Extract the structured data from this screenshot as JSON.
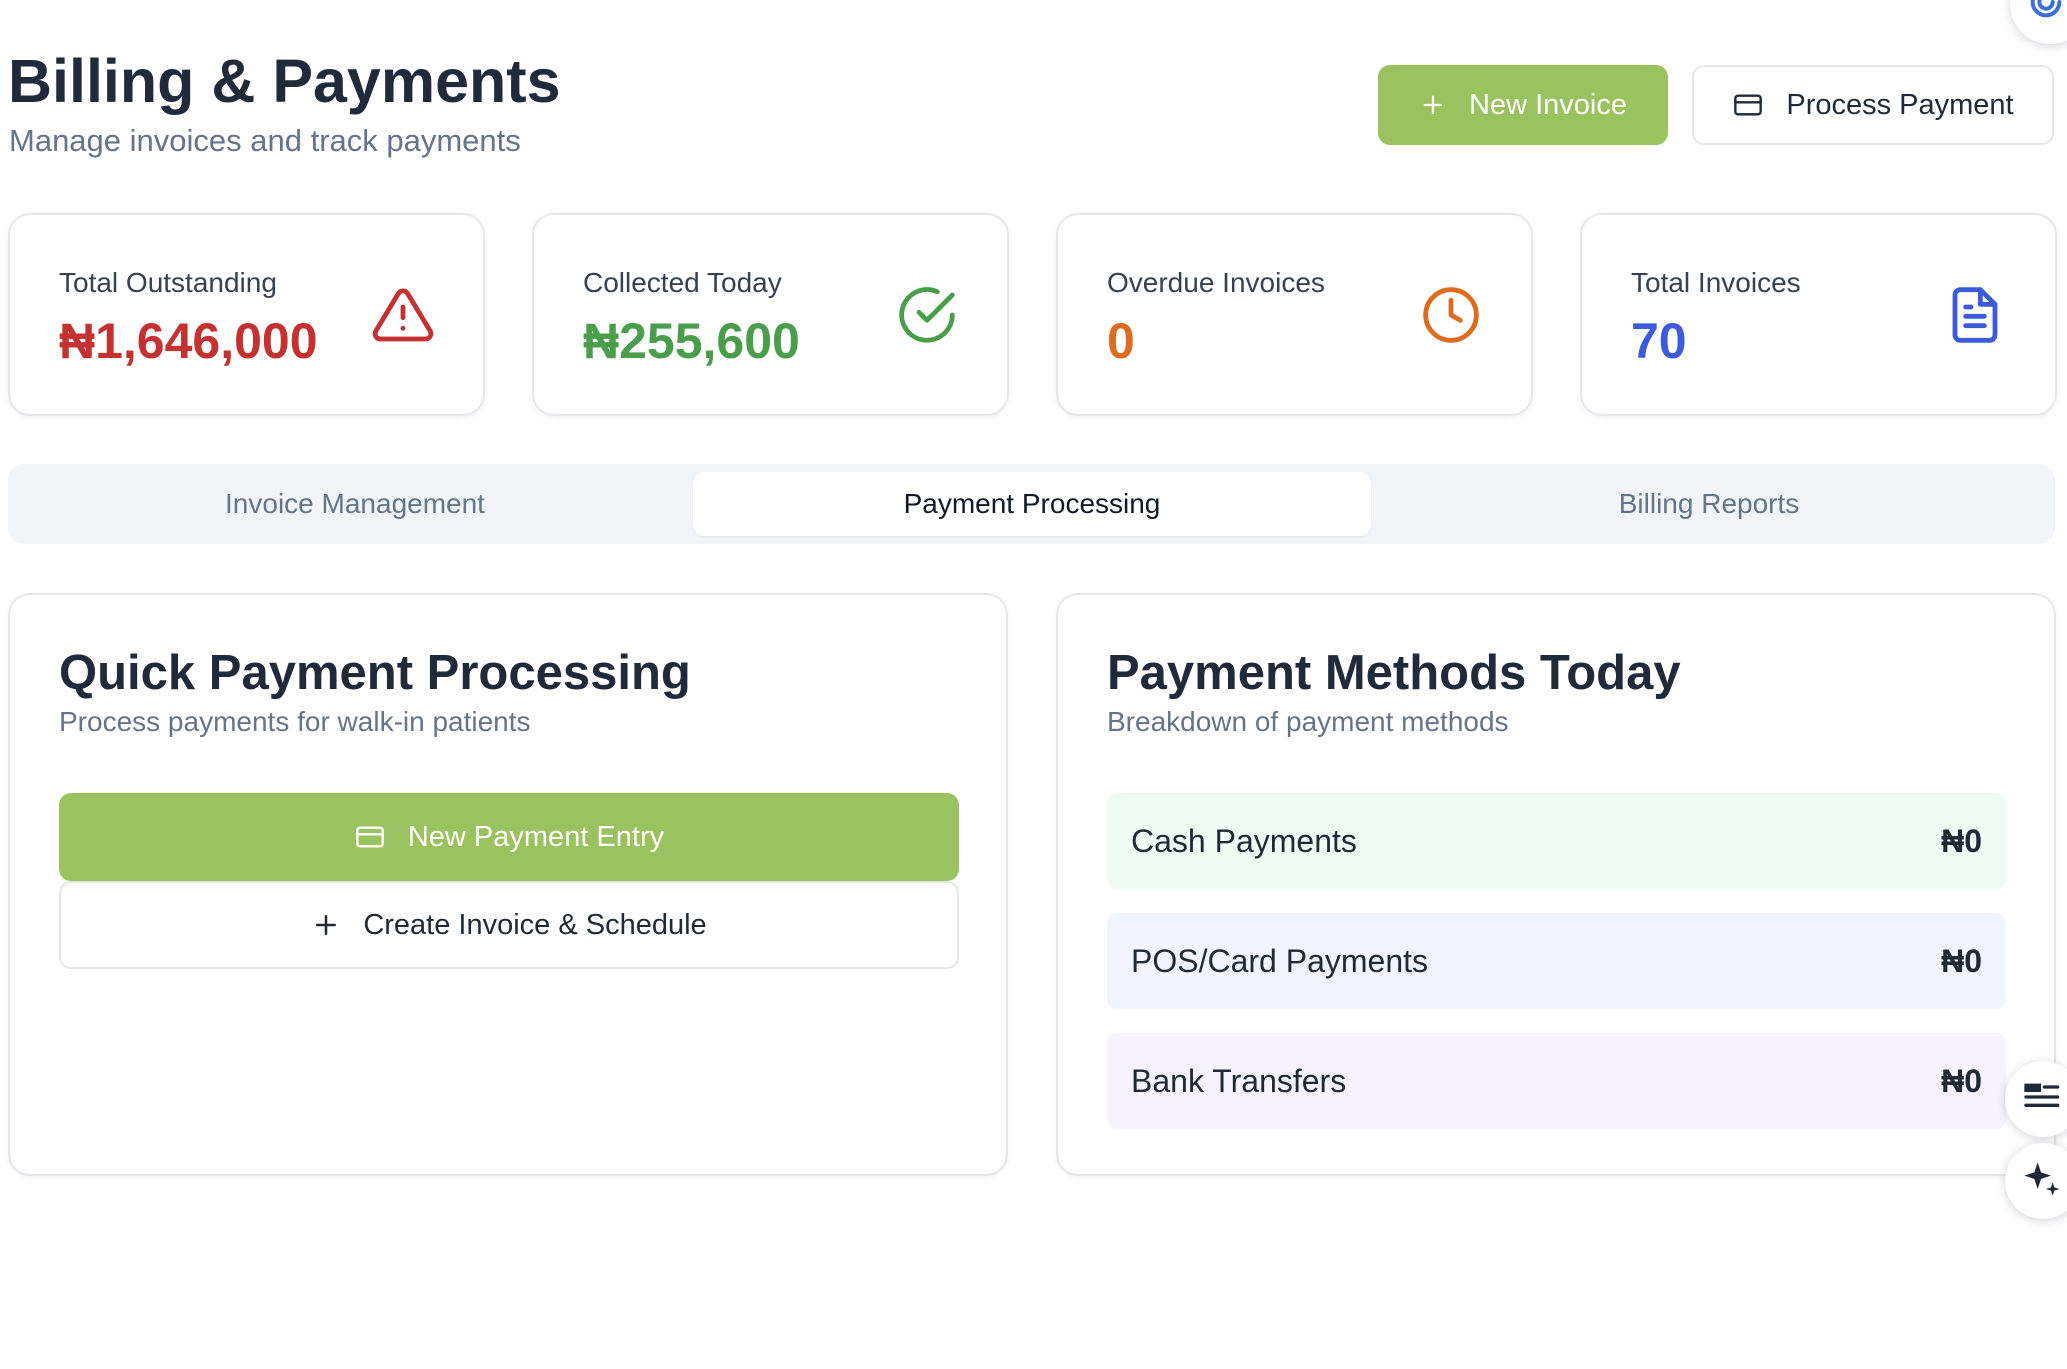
{
  "header": {
    "title": "Billing & Payments",
    "subtitle": "Manage invoices and track payments",
    "new_invoice_label": "New Invoice",
    "process_payment_label": "Process Payment"
  },
  "stats": [
    {
      "label": "Total Outstanding",
      "value": "₦1,646,000",
      "color": "#c53030",
      "icon": "alert-triangle-icon"
    },
    {
      "label": "Collected Today",
      "value": "₦255,600",
      "color": "#4a9d4a",
      "icon": "check-circle-icon"
    },
    {
      "label": "Overdue Invoices",
      "value": "0",
      "color": "#dd6b20",
      "icon": "clock-icon"
    },
    {
      "label": "Total Invoices",
      "value": "70",
      "color": "#3b5bdb",
      "icon": "document-icon"
    }
  ],
  "tabs": [
    {
      "label": "Invoice Management",
      "active": false
    },
    {
      "label": "Payment Processing",
      "active": true
    },
    {
      "label": "Billing Reports",
      "active": false
    }
  ],
  "quick_payment": {
    "title": "Quick Payment Processing",
    "subtitle": "Process payments for walk-in patients",
    "new_payment_label": "New Payment Entry",
    "create_invoice_label": "Create Invoice & Schedule"
  },
  "payment_methods": {
    "title": "Payment Methods Today",
    "subtitle": "Breakdown of payment methods",
    "rows": [
      {
        "label": "Cash Payments",
        "amount": "₦0",
        "bg": "#f0fbf3"
      },
      {
        "label": "POS/Card Payments",
        "amount": "₦0",
        "bg": "#eff4fe"
      },
      {
        "label": "Bank Transfers",
        "amount": "₦0",
        "bg": "#f6f3fe"
      }
    ]
  },
  "colors": {
    "accent_green": "#9ac25f",
    "heading": "#1f2a3a",
    "muted": "#64748b"
  },
  "floating_icons": [
    "assistant-swirl-icon",
    "quote-list-icon",
    "sparkle-icon"
  ]
}
